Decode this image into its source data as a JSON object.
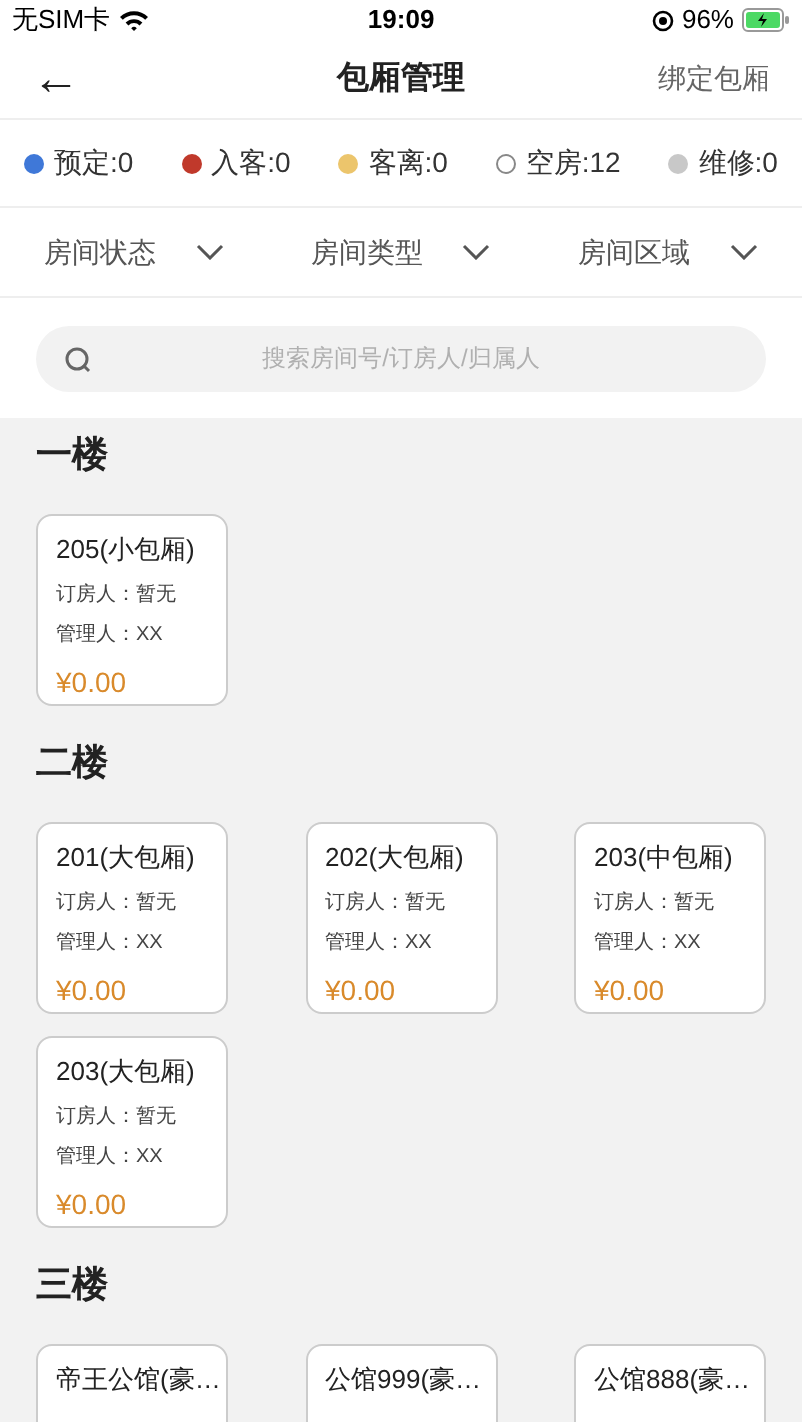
{
  "status_bar": {
    "carrier": "无SIM卡",
    "time": "19:09",
    "battery": "96%"
  },
  "header": {
    "back": "←",
    "title": "包厢管理",
    "action": "绑定包厢"
  },
  "legend": [
    {
      "label": "预定:0",
      "color": "#3f78d8"
    },
    {
      "label": "入客:0",
      "color": "#c0392b"
    },
    {
      "label": "客离:0",
      "color": "#ecc56c"
    },
    {
      "label": "空房:12",
      "color": "#ffffff"
    },
    {
      "label": "维修:0",
      "color": "#c8c8c8"
    }
  ],
  "filters": [
    "房间状态",
    "房间类型",
    "房间区域"
  ],
  "search": {
    "placeholder": "搜索房间号/订房人/归属人"
  },
  "floors": [
    {
      "title": "一楼",
      "rooms": [
        {
          "name": "205(小包厢)",
          "booker": "订房人：暂无",
          "manager": "管理人：XX",
          "price": "¥0.00"
        }
      ]
    },
    {
      "title": "二楼",
      "rooms": [
        {
          "name": "201(大包厢)",
          "booker": "订房人：暂无",
          "manager": "管理人：XX",
          "price": "¥0.00"
        },
        {
          "name": "202(大包厢)",
          "booker": "订房人：暂无",
          "manager": "管理人：XX",
          "price": "¥0.00"
        },
        {
          "name": "203(中包厢)",
          "booker": "订房人：暂无",
          "manager": "管理人：XX",
          "price": "¥0.00"
        },
        {
          "name": "203(大包厢)",
          "booker": "订房人：暂无",
          "manager": "管理人：XX",
          "price": "¥0.00"
        }
      ]
    },
    {
      "title": "三楼",
      "rooms": [
        {
          "name": "帝王公馆(豪…"
        },
        {
          "name": "公馆999(豪…"
        },
        {
          "name": "公馆888(豪…"
        }
      ]
    }
  ]
}
